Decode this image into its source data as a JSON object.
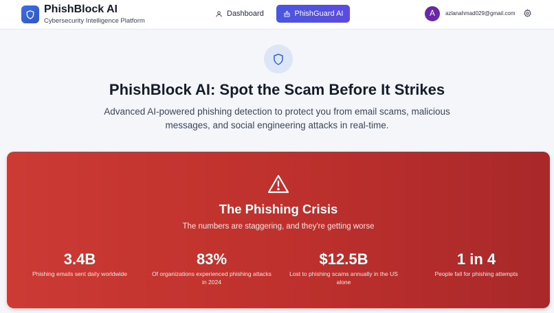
{
  "header": {
    "brand_title": "PhishBlock AI",
    "brand_subtitle": "Cybersecurity Intelligence Platform",
    "nav_dashboard": "Dashboard",
    "nav_phishguard": "PhishGuard AI",
    "avatar_initial": "A",
    "user_email": "azlanahmad029@gmail.com"
  },
  "hero": {
    "title": "PhishBlock AI: Spot the Scam Before It Strikes",
    "subtitle": "Advanced AI-powered phishing detection to protect you from email scams, malicious messages, and social engineering attacks in real-time."
  },
  "crisis": {
    "title": "The Phishing Crisis",
    "subtitle": "The numbers are staggering, and they're getting worse",
    "stats": [
      {
        "value": "3.4B",
        "label": "Phishing emails sent daily worldwide"
      },
      {
        "value": "83%",
        "label": "Of organizations experienced phishing attacks in 2024"
      },
      {
        "value": "$12.5B",
        "label": "Lost to phishing scams annually in the US alone"
      },
      {
        "value": "1 in 4",
        "label": "People fall for phishing attempts"
      }
    ]
  },
  "colors": {
    "brand": "#3c6fe0",
    "phishguard_button": "#4f52e0",
    "crisis_bg": "#c2322e",
    "avatar": "#6a27a8"
  },
  "icons": {
    "logo": "shield-icon",
    "dashboard": "user-icon",
    "phishguard": "bot-icon",
    "settings": "gear-icon",
    "hero": "shield-icon",
    "crisis": "warning-triangle-icon"
  }
}
